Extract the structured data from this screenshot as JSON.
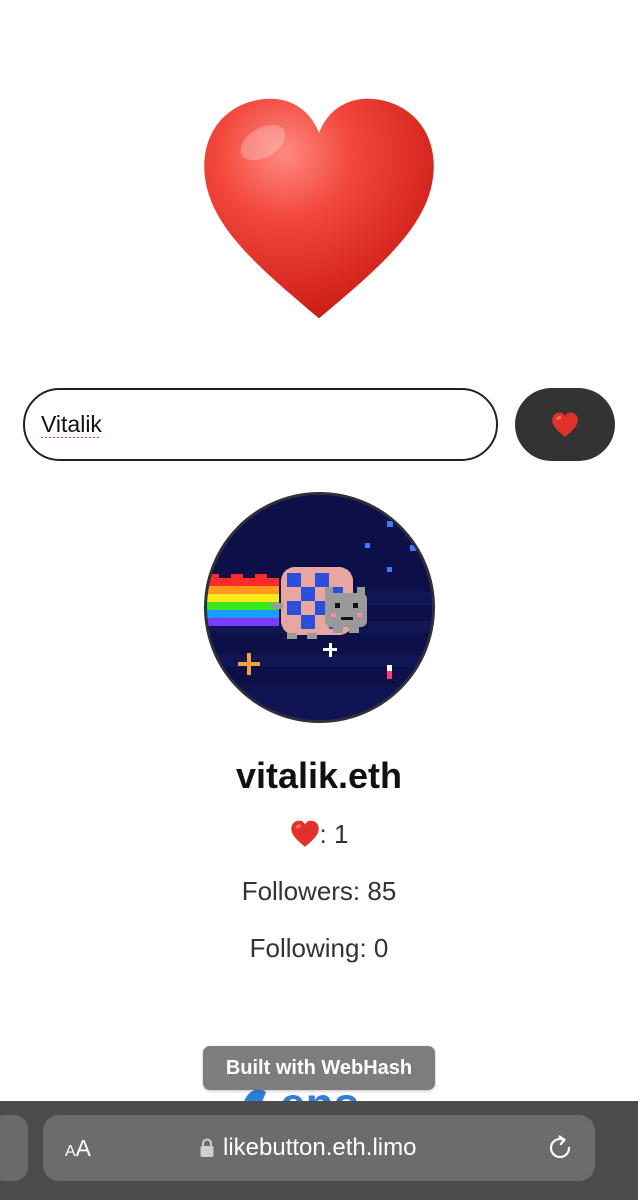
{
  "search": {
    "value": "Vitalik"
  },
  "profile": {
    "name": "vitalik.eth",
    "likes_label": ": 1",
    "followers_text": "Followers: 85",
    "following_text": "Following: 0"
  },
  "footer": {
    "badge_text": "Built with WebHash",
    "behind_logo_text": "ens"
  },
  "browser": {
    "aa_small": "A",
    "aa_large": "A",
    "url": "likebutton.eth.limo"
  },
  "colors": {
    "heart": "#e0322a",
    "like_button_bg": "#333333",
    "badge_bg": "#7d7d7d",
    "browser_bar_bg": "#4c4c4c",
    "ens_logo": "#2f7fd6"
  },
  "icons": {
    "hero": "heart-icon",
    "like_button": "heart-icon",
    "lock": "lock-icon",
    "reload": "reload-icon"
  }
}
